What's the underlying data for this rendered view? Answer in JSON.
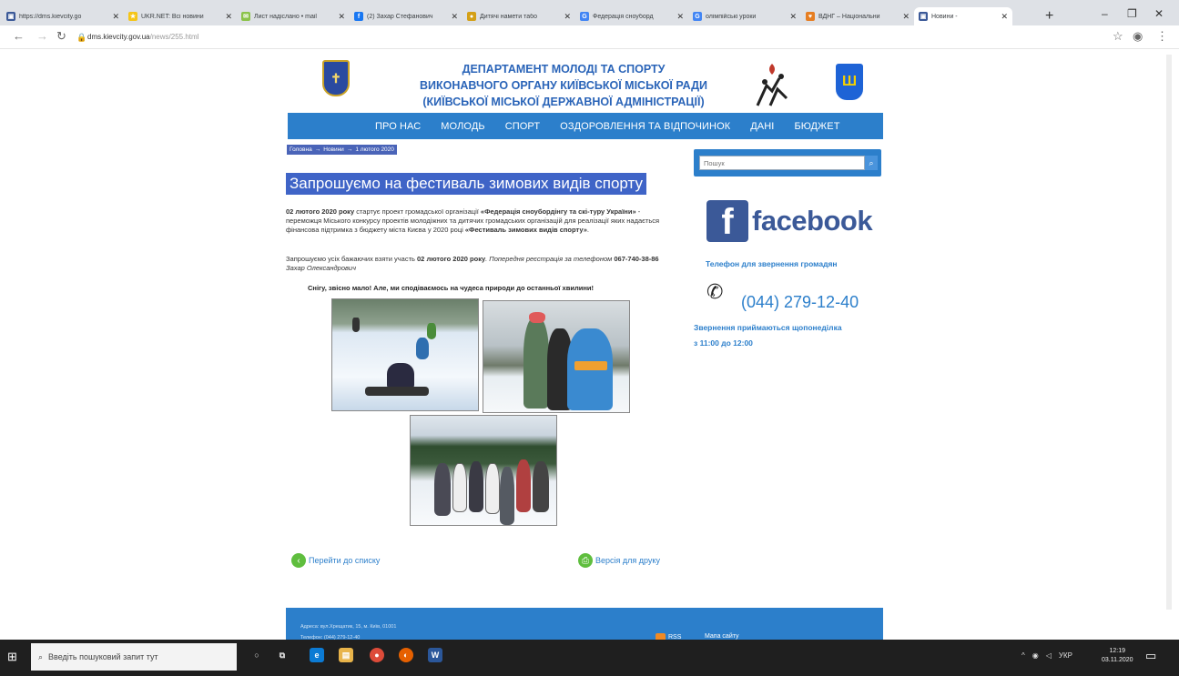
{
  "browser": {
    "tabs": [
      {
        "label": "https://dms.kievcity.go",
        "fav": "▣",
        "color": "#3b5998"
      },
      {
        "label": "UKR.NET: Всі новини",
        "fav": "★",
        "color": "#f5c518"
      },
      {
        "label": "Лист надіслано • mail",
        "fav": "✉",
        "color": "#8bc34a"
      },
      {
        "label": "(2) Захар Стефанович",
        "fav": "f",
        "color": "#1877f2"
      },
      {
        "label": "Дитячі намети табо",
        "fav": "●",
        "color": "#d4a017"
      },
      {
        "label": "Федерація сноуборд",
        "fav": "G",
        "color": "#4285f4"
      },
      {
        "label": "олімпійські уроки",
        "fav": "G",
        "color": "#4285f4"
      },
      {
        "label": "ВДНГ – Національни",
        "fav": "♥",
        "color": "#e67e22"
      },
      {
        "label": "Новини -",
        "fav": "▣",
        "color": "#3b5998",
        "active": true
      }
    ],
    "url_host": "dms.kievcity.gov.ua",
    "url_path": "/news/255.html"
  },
  "header": {
    "title_line1": "ДЕПАРТАМЕНТ МОЛОДІ ТА СПОРТУ",
    "title_line2": "ВИКОНАВЧОГО ОРГАНУ КИЇВСЬКОЇ МІСЬКОЇ РАДИ",
    "title_line3": "(КИЇВСЬКОЇ МІСЬКОЇ ДЕРЖАВНОЇ АДМІНІСТРАЦІЇ)"
  },
  "nav": {
    "items": [
      "ПРО НАС",
      "МОЛОДЬ",
      "СПОРТ",
      "ОЗДОРОВЛЕННЯ ТА ВІДПОЧИНОК",
      "ДАНІ",
      "БЮДЖЕТ"
    ]
  },
  "breadcrumb": {
    "home": "Головна",
    "section": "Новини",
    "current": "1 лютого 2020",
    "sep": "→"
  },
  "article": {
    "title": "Запрошуємо на фестиваль зимових видів спорту",
    "p1_date": "02 лютого 2020 року",
    "p1_text": " стартує проект громадської організації ",
    "p1_org": "«Федерація сноубордінгу та скі-туру України»",
    "p1_text2": " - переможця Міського конкурсу проектів молодіжних та дитячих громадських організацій для реалізації яких надається фінансова підтримка з бюджету міста Києва у 2020 році ",
    "p1_project": "«Фестиваль зимових видів спорту»",
    "p1_end": ".",
    "p2_text": "Запрошуємо усіх бажаючих взяти участь ",
    "p2_date": "02 лютого 2020 року",
    "p2_it1": ". Попередня реєстрація за телефоном ",
    "p2_phone": "067-740-38-86",
    "p2_name": " Захар Олександрович",
    "p3": "Снігу, звісно мало! Але, ми сподіваємось на чудеса природи до останньої хвилини!"
  },
  "links": {
    "back": "Перейти до списку",
    "print": "Версія для друку"
  },
  "footer": {
    "address": "Адреса: вул.Хрещатик, 15, м. Київ, 01001",
    "phone": "Телефон: (044) 279-12-40",
    "rss": "RSS",
    "sitemap": "Мапа сайту"
  },
  "sidebar": {
    "search_placeholder": "Пошук",
    "facebook_word": "facebook",
    "facebook_letter": "f",
    "phone_label": "Телефон для звернення громадян",
    "phone_number": "(044) 279-12-40",
    "hours_line1": "Звернення приймаються щопонеділка",
    "hours_line2": "з 11:00 до 12:00"
  },
  "taskbar": {
    "search_text": "Введіть пошуковий запит тут",
    "lang": "УКР",
    "time": "12:19",
    "date": "03.11.2020"
  }
}
